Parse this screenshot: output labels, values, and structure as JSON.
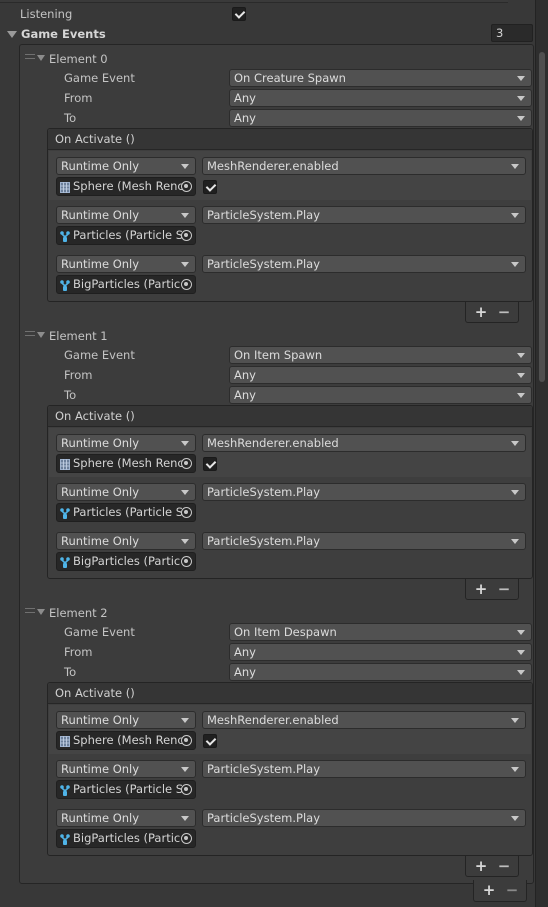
{
  "inspector": {
    "listening": {
      "label": "Listening",
      "checked": true
    },
    "game_events": {
      "label": "Game Events",
      "size": "3",
      "elements": [
        {
          "label": "Element 0",
          "fields": [
            {
              "label": "Game Event",
              "value": "On Creature Spawn"
            },
            {
              "label": "From",
              "value": "Any"
            },
            {
              "label": "To",
              "value": "Any"
            }
          ],
          "event": {
            "header": "On Activate ()",
            "listeners": [
              {
                "mode": "Runtime Only",
                "function": "MeshRenderer.enabled",
                "target": "Sphere (Mesh Renderer)",
                "target_display": "Sphere (Mesh Renc",
                "target_icon": "mesh-renderer-icon",
                "has_bool": true,
                "bool_value": true
              },
              {
                "mode": "Runtime Only",
                "function": "ParticleSystem.Play",
                "target": "Particles (Particle System)",
                "target_display": "Particles (Particle S",
                "target_icon": "particle-system-icon",
                "has_bool": false
              },
              {
                "mode": "Runtime Only",
                "function": "ParticleSystem.Play",
                "target": "BigParticles (Particle System)",
                "target_display": "BigParticles (Partic",
                "target_icon": "particle-system-icon",
                "has_bool": false
              }
            ],
            "add_label": "+",
            "remove_label": "−"
          }
        },
        {
          "label": "Element 1",
          "fields": [
            {
              "label": "Game Event",
              "value": "On Item Spawn"
            },
            {
              "label": "From",
              "value": "Any"
            },
            {
              "label": "To",
              "value": "Any"
            }
          ],
          "event": {
            "header": "On Activate ()",
            "listeners": [
              {
                "mode": "Runtime Only",
                "function": "MeshRenderer.enabled",
                "target": "Sphere (Mesh Renderer)",
                "target_display": "Sphere (Mesh Renc",
                "target_icon": "mesh-renderer-icon",
                "has_bool": true,
                "bool_value": true
              },
              {
                "mode": "Runtime Only",
                "function": "ParticleSystem.Play",
                "target": "Particles (Particle System)",
                "target_display": "Particles (Particle S",
                "target_icon": "particle-system-icon",
                "has_bool": false
              },
              {
                "mode": "Runtime Only",
                "function": "ParticleSystem.Play",
                "target": "BigParticles (Particle System)",
                "target_display": "BigParticles (Partic",
                "target_icon": "particle-system-icon",
                "has_bool": false
              }
            ],
            "add_label": "+",
            "remove_label": "−"
          }
        },
        {
          "label": "Element 2",
          "fields": [
            {
              "label": "Game Event",
              "value": "On Item Despawn"
            },
            {
              "label": "From",
              "value": "Any"
            },
            {
              "label": "To",
              "value": "Any"
            }
          ],
          "event": {
            "header": "On Activate ()",
            "listeners": [
              {
                "mode": "Runtime Only",
                "function": "MeshRenderer.enabled",
                "target": "Sphere (Mesh Renderer)",
                "target_display": "Sphere (Mesh Renc",
                "target_icon": "mesh-renderer-icon",
                "has_bool": true,
                "bool_value": true
              },
              {
                "mode": "Runtime Only",
                "function": "ParticleSystem.Play",
                "target": "Particles (Particle System)",
                "target_display": "Particles (Particle S",
                "target_icon": "particle-system-icon",
                "has_bool": false
              },
              {
                "mode": "Runtime Only",
                "function": "ParticleSystem.Play",
                "target": "BigParticles (Particle System)",
                "target_display": "BigParticles (Partic",
                "target_icon": "particle-system-icon",
                "has_bool": false
              }
            ],
            "add_label": "+",
            "remove_label": "−"
          }
        }
      ],
      "add_label": "+",
      "remove_label": "−"
    }
  },
  "colors": {
    "background": "#383838",
    "particle_icon": "#4fb4e8"
  }
}
